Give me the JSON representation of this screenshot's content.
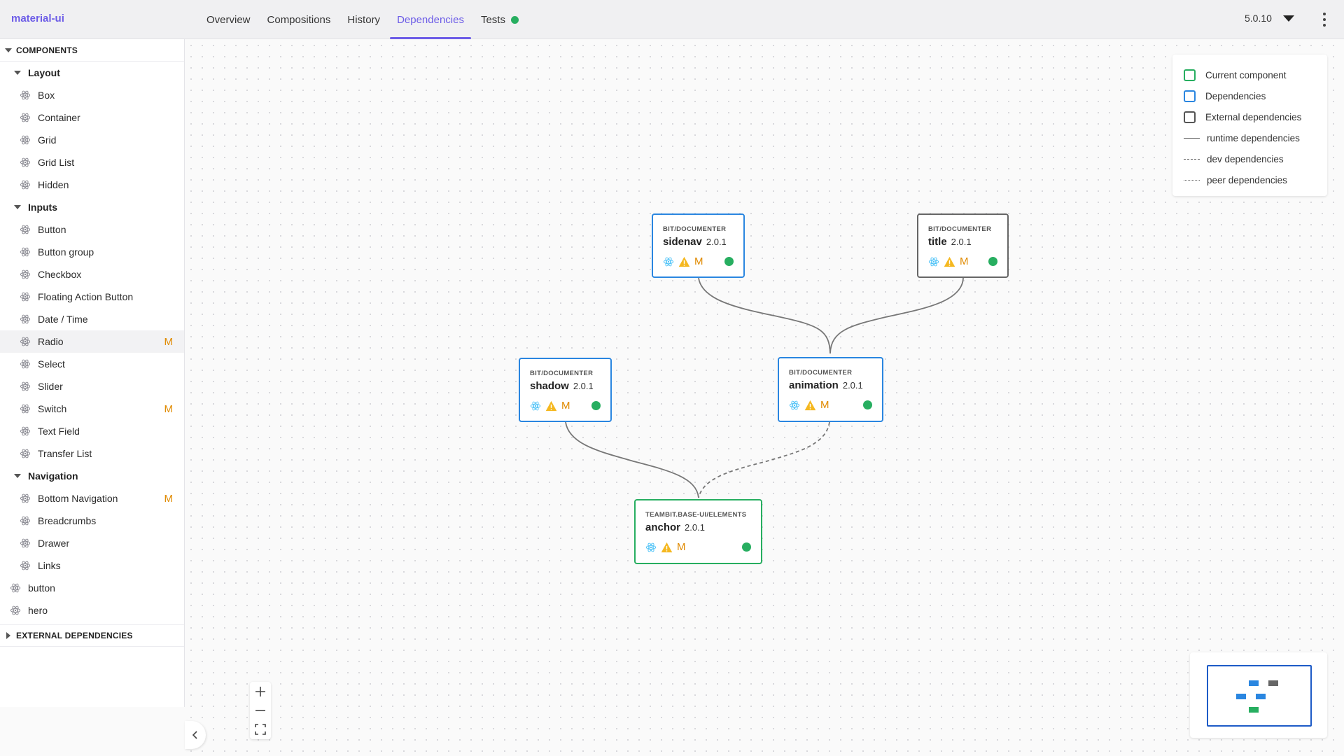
{
  "app": {
    "brand": "material-ui",
    "version": "5.0.10"
  },
  "tabs": [
    {
      "label": "Overview"
    },
    {
      "label": "Compositions"
    },
    {
      "label": "History"
    },
    {
      "label": "Dependencies"
    },
    {
      "label": "Tests"
    }
  ],
  "sidebar": {
    "components_title": "COMPONENTS",
    "groups": [
      {
        "label": "Layout",
        "items": [
          "Box",
          "Container",
          "Grid",
          "Grid List",
          "Hidden"
        ]
      },
      {
        "label": "Inputs",
        "items": [
          "Button",
          "Button group",
          "Checkbox",
          "Floating Action Button",
          "Date / Time",
          "Radio",
          "Select",
          "Slider",
          "Switch",
          "Text Field",
          "Transfer List"
        ]
      },
      {
        "label": "Navigation",
        "items": [
          "Bottom Navigation",
          "Breadcrumbs",
          "Drawer",
          "Links"
        ]
      }
    ],
    "modified_mark": "M",
    "top_items": [
      "button",
      "hero"
    ],
    "external_title": "EXTERNAL DEPENDENCIES"
  },
  "graph": {
    "nodes": [
      {
        "id": "sidenav",
        "scope": "BIT/DOCUMENTER",
        "name": "sidenav",
        "version": "2.0.1",
        "kind": "dependency"
      },
      {
        "id": "title",
        "scope": "BIT/DOCUMENTER",
        "name": "title",
        "version": "2.0.1",
        "kind": "external"
      },
      {
        "id": "shadow",
        "scope": "BIT/DOCUMENTER",
        "name": "shadow",
        "version": "2.0.1",
        "kind": "dependency"
      },
      {
        "id": "animation",
        "scope": "BIT/DOCUMENTER",
        "name": "animation",
        "version": "2.0.1",
        "kind": "dependency"
      },
      {
        "id": "anchor",
        "scope": "TEAMBIT.BASE-UI/ELEMENTS",
        "name": "anchor",
        "version": "2.0.1",
        "kind": "current"
      }
    ],
    "edges": [
      {
        "from": "animation",
        "to": "sidenav",
        "type": "runtime"
      },
      {
        "from": "animation",
        "to": "title",
        "type": "runtime"
      },
      {
        "from": "anchor",
        "to": "shadow",
        "type": "runtime"
      },
      {
        "from": "anchor",
        "to": "animation",
        "type": "dev"
      }
    ],
    "modified_mark": "M"
  },
  "legend": {
    "current": "Current component",
    "dependencies": "Dependencies",
    "external": "External dependencies",
    "runtime": "runtime dependencies",
    "dev": "dev dependencies",
    "peer": "peer dependencies"
  },
  "colors": {
    "accent": "#6c5ce7",
    "current": "#27ae60",
    "dependency": "#2a86e0",
    "external": "#666666",
    "modified": "#e08a00",
    "status_ok": "#27ae60"
  }
}
